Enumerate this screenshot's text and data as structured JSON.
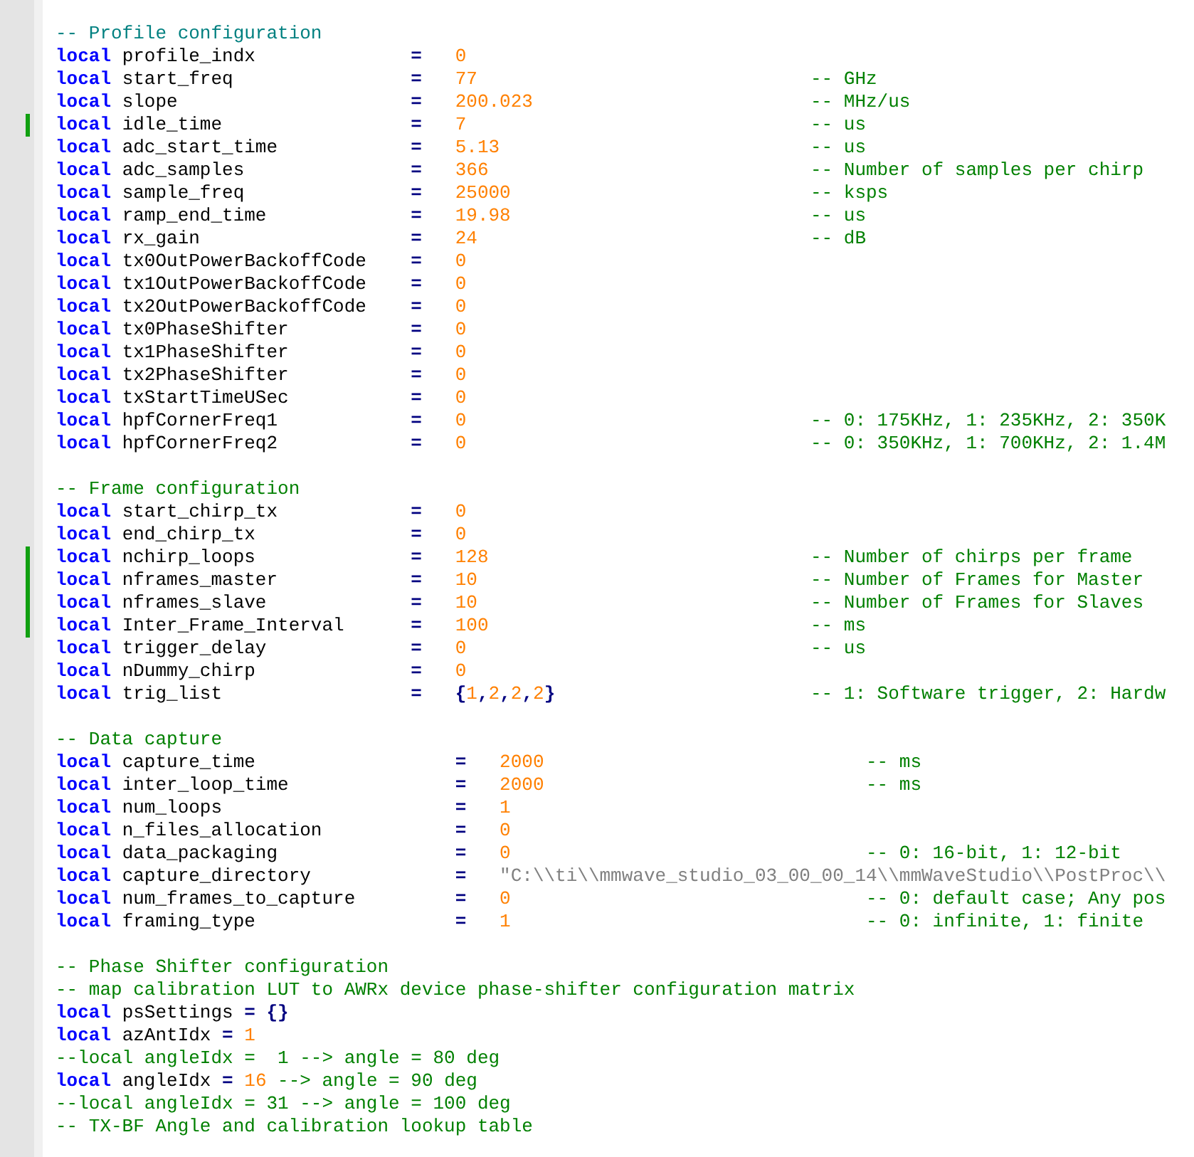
{
  "editor": {
    "sections": [
      {
        "kind": "narrow",
        "lines": [
          {
            "kind": "doc_comment",
            "changed": false,
            "text": "-- Profile configuration"
          },
          {
            "kind": "assign",
            "changed": false,
            "keyword": "local",
            "name": "profile_indx",
            "op": "=",
            "value": {
              "kind": "number",
              "text": "0"
            }
          },
          {
            "kind": "assign",
            "changed": false,
            "keyword": "local",
            "name": "start_freq",
            "op": "=",
            "value": {
              "kind": "number",
              "text": "77"
            },
            "comment": "-- GHz"
          },
          {
            "kind": "assign",
            "changed": false,
            "keyword": "local",
            "name": "slope",
            "op": "=",
            "value": {
              "kind": "number",
              "text": "200.023"
            },
            "comment": "-- MHz/us"
          },
          {
            "kind": "assign",
            "changed": true,
            "keyword": "local",
            "name": "idle_time",
            "op": "=",
            "value": {
              "kind": "number",
              "text": "7"
            },
            "comment": "-- us"
          },
          {
            "kind": "assign",
            "changed": false,
            "keyword": "local",
            "name": "adc_start_time",
            "op": "=",
            "value": {
              "kind": "number",
              "text": "5.13"
            },
            "comment": "-- us"
          },
          {
            "kind": "assign",
            "changed": false,
            "keyword": "local",
            "name": "adc_samples",
            "op": "=",
            "value": {
              "kind": "number",
              "text": "366"
            },
            "comment": "-- Number of samples per chirp"
          },
          {
            "kind": "assign",
            "changed": false,
            "keyword": "local",
            "name": "sample_freq",
            "op": "=",
            "value": {
              "kind": "number",
              "text": "25000"
            },
            "comment": "-- ksps"
          },
          {
            "kind": "assign",
            "changed": false,
            "keyword": "local",
            "name": "ramp_end_time",
            "op": "=",
            "value": {
              "kind": "number",
              "text": "19.98"
            },
            "comment": "-- us"
          },
          {
            "kind": "assign",
            "changed": false,
            "keyword": "local",
            "name": "rx_gain",
            "op": "=",
            "value": {
              "kind": "number",
              "text": "24"
            },
            "comment": "-- dB"
          },
          {
            "kind": "assign",
            "changed": false,
            "keyword": "local",
            "name": "tx0OutPowerBackoffCode",
            "op": "=",
            "value": {
              "kind": "number",
              "text": "0"
            }
          },
          {
            "kind": "assign",
            "changed": false,
            "keyword": "local",
            "name": "tx1OutPowerBackoffCode",
            "op": "=",
            "value": {
              "kind": "number",
              "text": "0"
            }
          },
          {
            "kind": "assign",
            "changed": false,
            "keyword": "local",
            "name": "tx2OutPowerBackoffCode",
            "op": "=",
            "value": {
              "kind": "number",
              "text": "0"
            }
          },
          {
            "kind": "assign",
            "changed": false,
            "keyword": "local",
            "name": "tx0PhaseShifter",
            "op": "=",
            "value": {
              "kind": "number",
              "text": "0"
            }
          },
          {
            "kind": "assign",
            "changed": false,
            "keyword": "local",
            "name": "tx1PhaseShifter",
            "op": "=",
            "value": {
              "kind": "number",
              "text": "0"
            }
          },
          {
            "kind": "assign",
            "changed": false,
            "keyword": "local",
            "name": "tx2PhaseShifter",
            "op": "=",
            "value": {
              "kind": "number",
              "text": "0"
            }
          },
          {
            "kind": "assign",
            "changed": false,
            "keyword": "local",
            "name": "txStartTimeUSec",
            "op": "=",
            "value": {
              "kind": "number",
              "text": "0"
            }
          },
          {
            "kind": "assign",
            "changed": false,
            "keyword": "local",
            "name": "hpfCornerFreq1",
            "op": "=",
            "value": {
              "kind": "number",
              "text": "0"
            },
            "comment": "-- 0: 175KHz, 1: 235KHz, 2: 350K"
          },
          {
            "kind": "assign",
            "changed": false,
            "keyword": "local",
            "name": "hpfCornerFreq2",
            "op": "=",
            "value": {
              "kind": "number",
              "text": "0"
            },
            "comment": "-- 0: 350KHz, 1: 700KHz, 2: 1.4M"
          }
        ]
      },
      {
        "kind": "narrow",
        "lines": [
          {
            "kind": "comment",
            "changed": false,
            "text": "-- Frame configuration"
          },
          {
            "kind": "assign",
            "changed": false,
            "keyword": "local",
            "name": "start_chirp_tx",
            "op": "=",
            "value": {
              "kind": "number",
              "text": "0"
            }
          },
          {
            "kind": "assign",
            "changed": false,
            "keyword": "local",
            "name": "end_chirp_tx",
            "op": "=",
            "value": {
              "kind": "number",
              "text": "0"
            }
          },
          {
            "kind": "assign",
            "changed": true,
            "keyword": "local",
            "name": "nchirp_loops",
            "op": "=",
            "value": {
              "kind": "number",
              "text": "128"
            },
            "comment": "-- Number of chirps per frame"
          },
          {
            "kind": "assign",
            "changed": true,
            "keyword": "local",
            "name": "nframes_master",
            "op": "=",
            "value": {
              "kind": "number",
              "text": "10"
            },
            "comment": "-- Number of Frames for Master"
          },
          {
            "kind": "assign",
            "changed": true,
            "keyword": "local",
            "name": "nframes_slave",
            "op": "=",
            "value": {
              "kind": "number",
              "text": "10"
            },
            "comment": "-- Number of Frames for Slaves"
          },
          {
            "kind": "assign",
            "changed": true,
            "keyword": "local",
            "name": "Inter_Frame_Interval",
            "op": "=",
            "value": {
              "kind": "number",
              "text": "100"
            },
            "comment": "-- ms"
          },
          {
            "kind": "assign",
            "changed": false,
            "keyword": "local",
            "name": "trigger_delay",
            "op": "=",
            "value": {
              "kind": "number",
              "text": "0"
            },
            "comment": "-- us"
          },
          {
            "kind": "assign",
            "changed": false,
            "keyword": "local",
            "name": "nDummy_chirp",
            "op": "=",
            "value": {
              "kind": "number",
              "text": "0"
            }
          },
          {
            "kind": "assign",
            "changed": false,
            "keyword": "local",
            "name": "trig_list",
            "op": "=",
            "value": {
              "kind": "table",
              "text": "{1,2,2,2}"
            },
            "comment": "-- 1: Software trigger, 2: Hardw"
          }
        ]
      },
      {
        "kind": "wide",
        "lines": [
          {
            "kind": "comment",
            "changed": false,
            "text": "-- Data capture"
          },
          {
            "kind": "assign",
            "changed": false,
            "keyword": "local",
            "name": "capture_time",
            "op": "=",
            "value": {
              "kind": "number",
              "text": "2000"
            },
            "comment": "-- ms"
          },
          {
            "kind": "assign",
            "changed": false,
            "keyword": "local",
            "name": "inter_loop_time",
            "op": "=",
            "value": {
              "kind": "number",
              "text": "2000"
            },
            "comment": "-- ms"
          },
          {
            "kind": "assign",
            "changed": false,
            "keyword": "local",
            "name": "num_loops",
            "op": "=",
            "value": {
              "kind": "number",
              "text": "1"
            }
          },
          {
            "kind": "assign",
            "changed": false,
            "keyword": "local",
            "name": "n_files_allocation",
            "op": "=",
            "value": {
              "kind": "number",
              "text": "0"
            }
          },
          {
            "kind": "assign",
            "changed": false,
            "keyword": "local",
            "name": "data_packaging",
            "op": "=",
            "value": {
              "kind": "number",
              "text": "0"
            },
            "comment": "-- 0: 16-bit, 1: 12-bit"
          },
          {
            "kind": "assign",
            "changed": false,
            "keyword": "local",
            "name": "capture_directory",
            "op": "=",
            "value": {
              "kind": "string",
              "text": "\"C:\\\\ti\\\\mmwave_studio_03_00_00_14\\\\mmWaveStudio\\\\PostProc\\\\"
            }
          },
          {
            "kind": "assign",
            "changed": false,
            "keyword": "local",
            "name": "num_frames_to_capture",
            "op": "=",
            "value": {
              "kind": "number",
              "text": "0"
            },
            "comment": "-- 0: default case; Any pos"
          },
          {
            "kind": "assign",
            "changed": false,
            "keyword": "local",
            "name": "framing_type",
            "op": "=",
            "value": {
              "kind": "number",
              "text": "1"
            },
            "comment": "-- 0: infinite, 1: finite"
          }
        ]
      },
      {
        "kind": "free",
        "lines": [
          {
            "kind": "comment",
            "changed": false,
            "text": "-- Phase Shifter configuration"
          },
          {
            "kind": "comment",
            "changed": false,
            "text": "-- map calibration LUT to AWRx device phase-shifter configuration matrix"
          },
          {
            "kind": "free",
            "changed": false,
            "tokens": [
              {
                "kind": "keyword",
                "text": "local"
              },
              {
                "kind": "name",
                "text": "psSettings"
              },
              {
                "kind": "op",
                "text": "="
              },
              {
                "kind": "table",
                "text": "{}"
              }
            ]
          },
          {
            "kind": "free",
            "changed": false,
            "tokens": [
              {
                "kind": "keyword",
                "text": "local"
              },
              {
                "kind": "name",
                "text": "azAntIdx"
              },
              {
                "kind": "op",
                "text": "="
              },
              {
                "kind": "number",
                "text": "1"
              }
            ]
          },
          {
            "kind": "comment",
            "changed": false,
            "text": "--local angleIdx =  1 --> angle = 80 deg"
          },
          {
            "kind": "free",
            "changed": false,
            "tokens": [
              {
                "kind": "keyword",
                "text": "local"
              },
              {
                "kind": "name",
                "text": "angleIdx"
              },
              {
                "kind": "op",
                "text": "="
              },
              {
                "kind": "number",
                "text": "16"
              },
              {
                "kind": "comment",
                "text": "--> angle = 90 deg"
              }
            ]
          },
          {
            "kind": "comment",
            "changed": false,
            "text": "--local angleIdx = 31 --> angle = 100 deg"
          },
          {
            "kind": "comment",
            "changed": false,
            "text": "-- TX-BF Angle and calibration lookup table"
          }
        ]
      }
    ]
  }
}
